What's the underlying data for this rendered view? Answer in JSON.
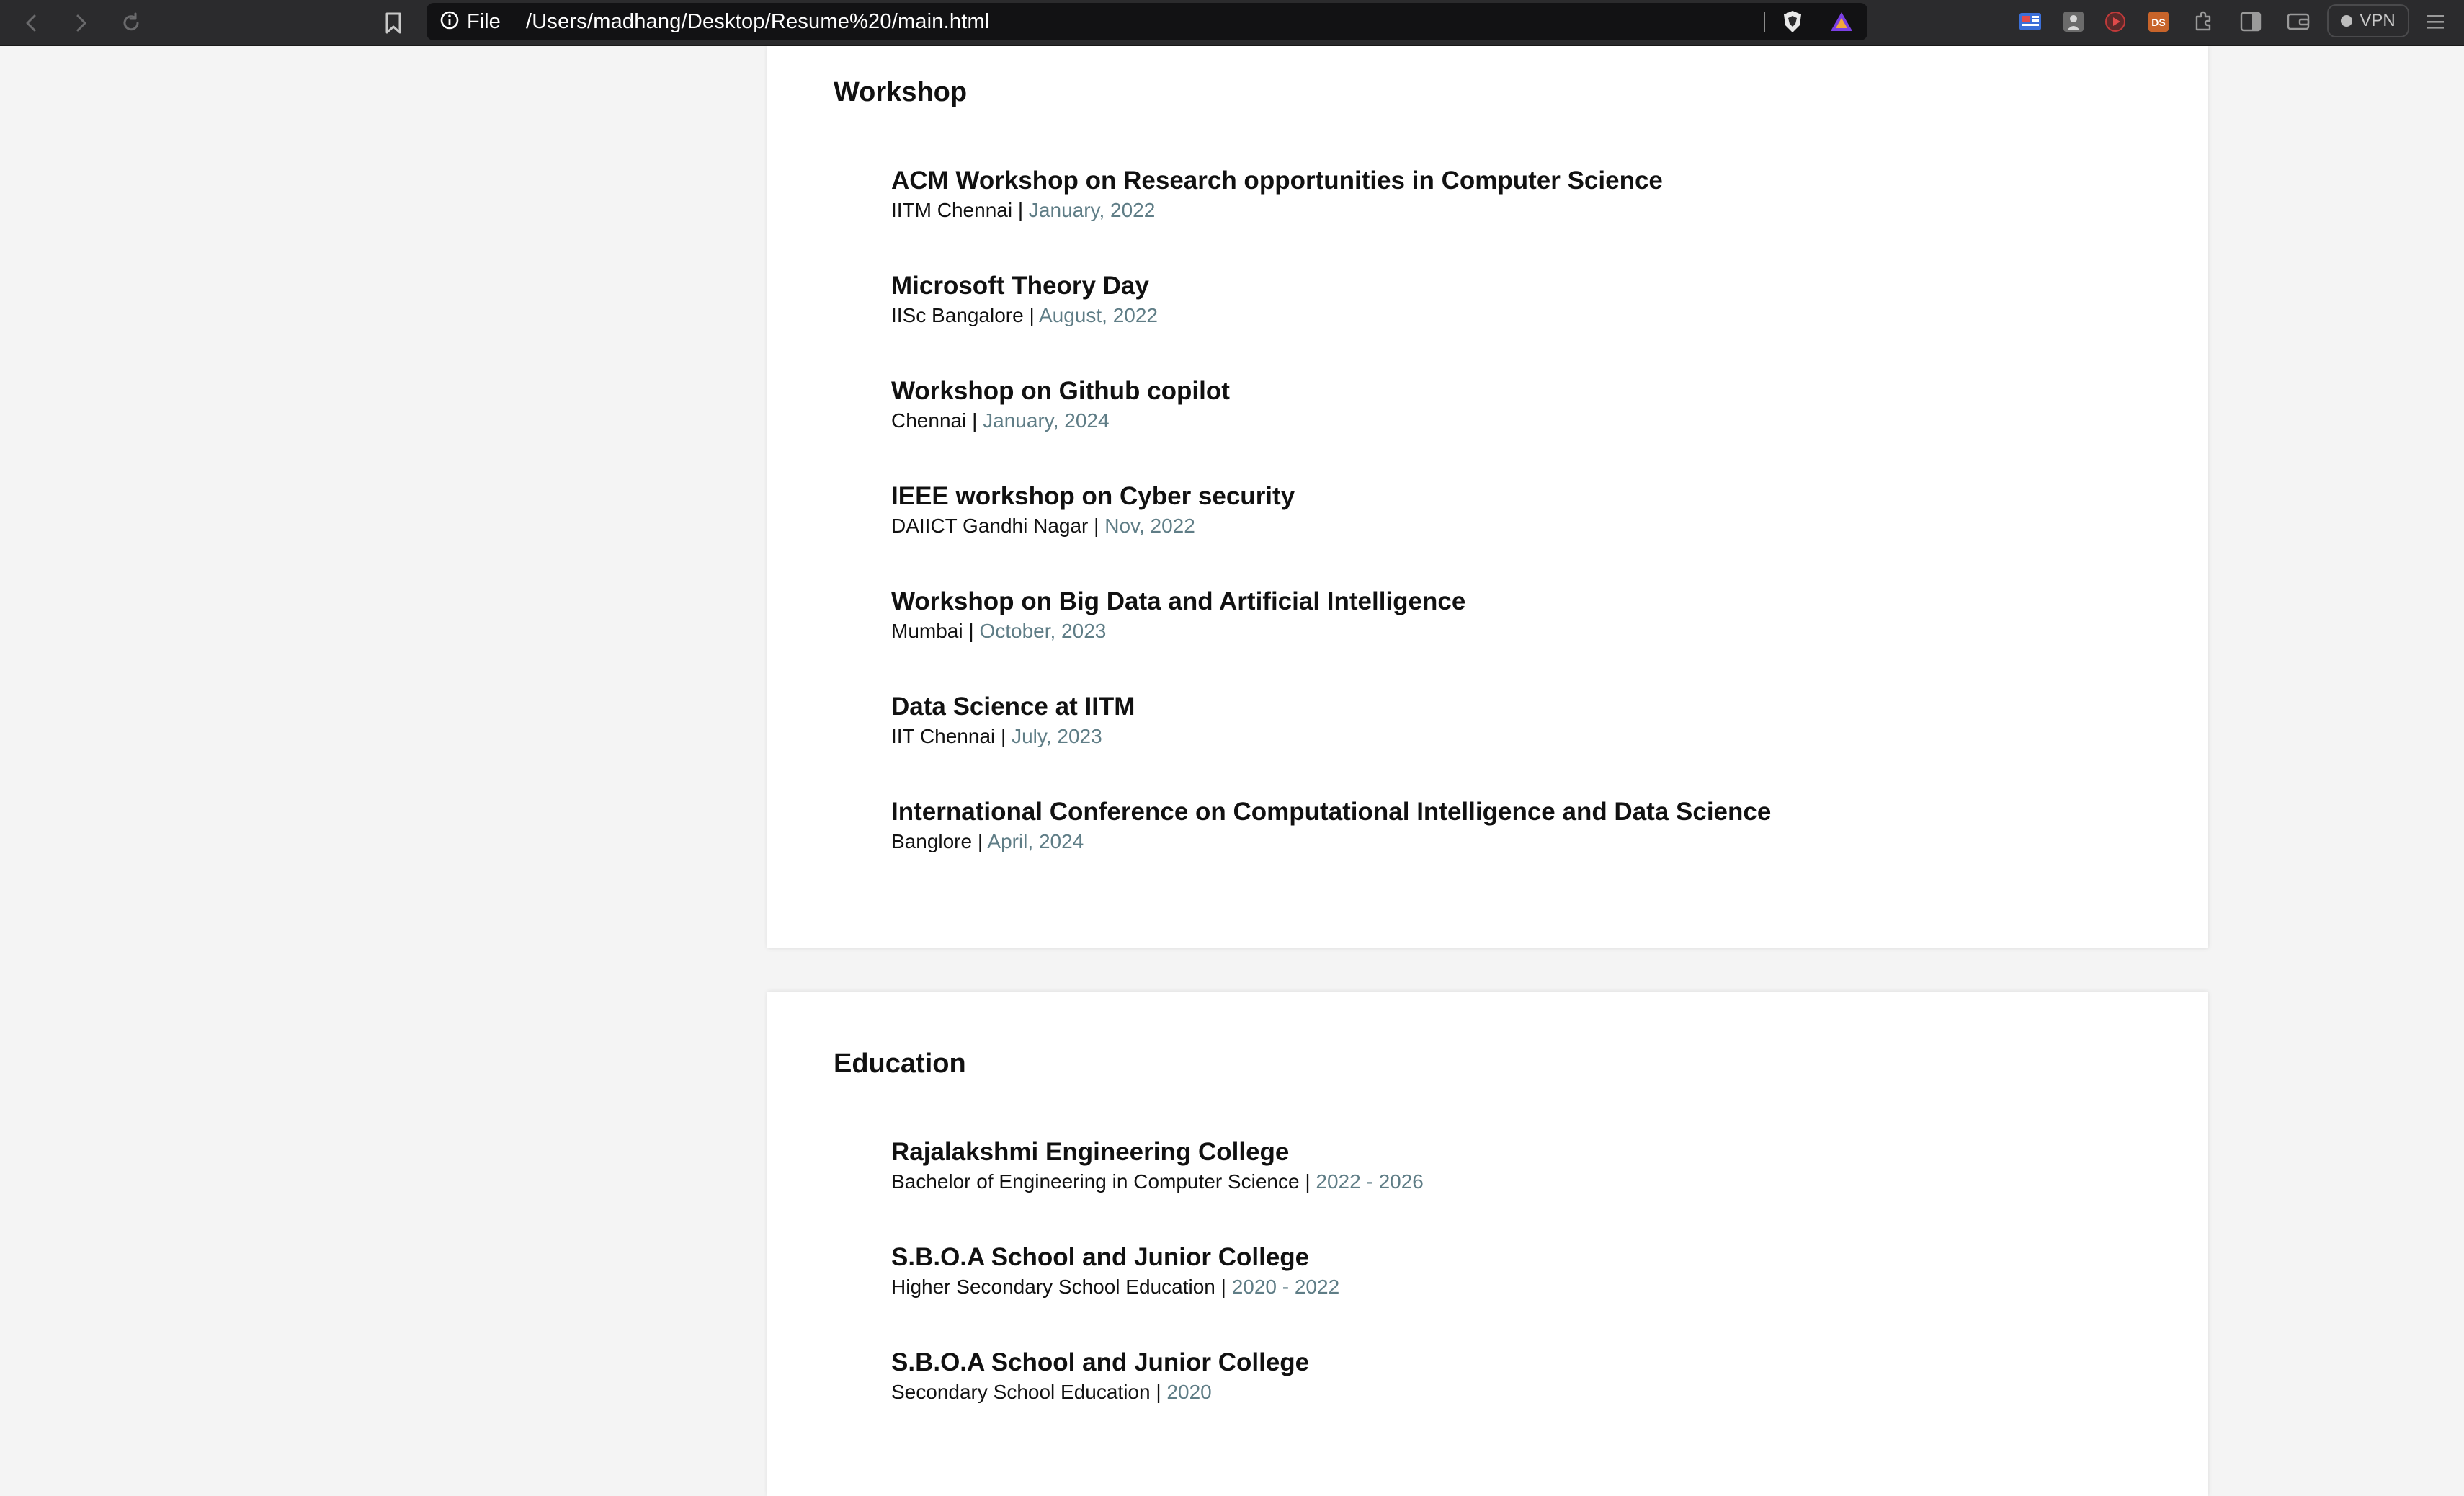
{
  "browser": {
    "url_scheme_label": "File",
    "url": "/Users/madhang/Desktop/Resume%20/main.html",
    "vpn_label": "VPN",
    "icons": {
      "back": "back-arrow-icon",
      "forward": "forward-arrow-icon",
      "reload": "reload-icon",
      "bookmark": "bookmark-icon",
      "info": "info-icon",
      "brave_shield": "brave-shield-icon",
      "brave_rewards": "brave-rewards-icon",
      "menu": "hamburger-menu-icon"
    }
  },
  "sections": {
    "workshop": {
      "title": "Workshop",
      "items": [
        {
          "title": "ACM Workshop on Research opportunities in Computer Science",
          "place": "IITM Chennai",
          "sep": "|",
          "date": "January, 2022"
        },
        {
          "title": "Microsoft Theory Day",
          "place": "IISc Bangalore",
          "sep": "|",
          "date": "August, 2022"
        },
        {
          "title": "Workshop on Github copilot",
          "place": "Chennai",
          "sep": "|",
          "date": "January, 2024"
        },
        {
          "title": "IEEE workshop on Cyber security",
          "place": "DAIICT Gandhi Nagar",
          "sep": "|",
          "date": "Nov, 2022"
        },
        {
          "title": "Workshop on Big Data and Artificial Intelligence",
          "place": "Mumbai",
          "sep": "|",
          "date": "October, 2023"
        },
        {
          "title": "Data Science at IITM",
          "place": "IIT Chennai",
          "sep": "|",
          "date": "July, 2023"
        },
        {
          "title": "International Conference on Computational Intelligence and Data Science",
          "place": "Banglore",
          "sep": "|",
          "date": "April, 2024"
        }
      ]
    },
    "education": {
      "title": "Education",
      "items": [
        {
          "title": "Rajalakshmi Engineering College",
          "place": "Bachelor of Engineering in Computer Science",
          "sep": "|",
          "date": "2022 - 2026"
        },
        {
          "title": "S.B.O.A School and Junior College",
          "place": "Higher Secondary School Education",
          "sep": "|",
          "date": "2020 - 2022"
        },
        {
          "title": "S.B.O.A School and Junior College",
          "place": "Secondary School Education",
          "sep": "|",
          "date": "2020"
        }
      ]
    }
  },
  "colors": {
    "page_bg": "#f4f4f4",
    "card_bg": "#ffffff",
    "date_accent": "#5f7d86",
    "toolbar_bg": "#2b2b2d"
  }
}
